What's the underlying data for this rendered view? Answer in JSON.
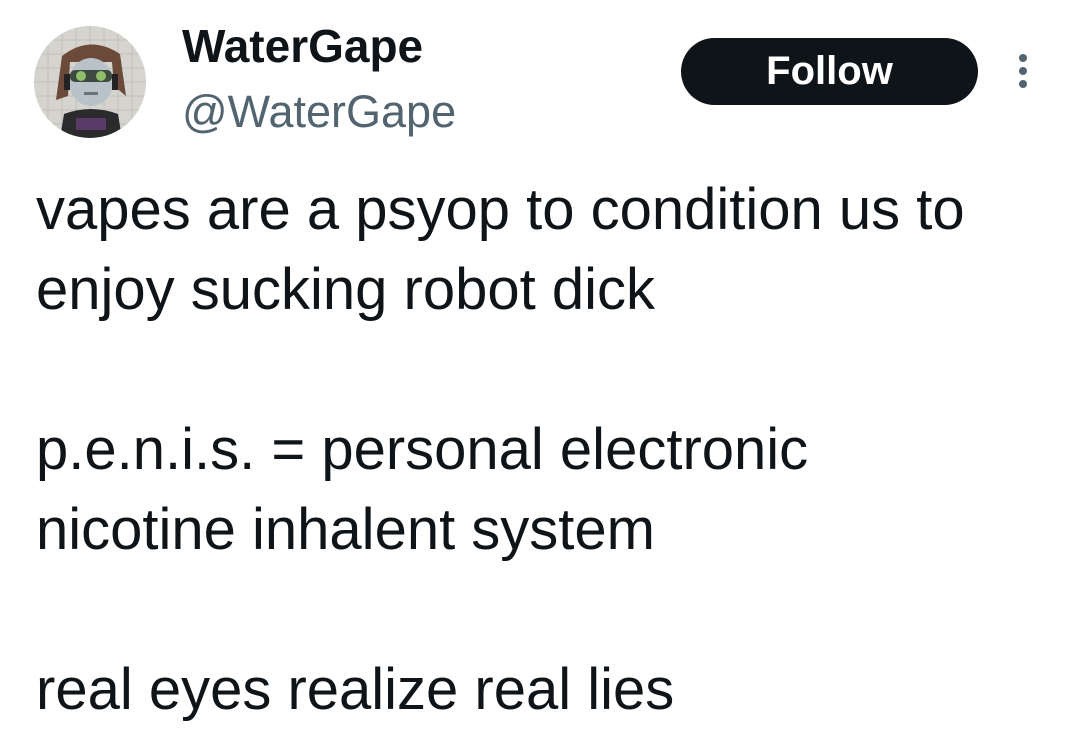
{
  "author": {
    "display_name": "WaterGape",
    "handle": "@WaterGape",
    "avatar_icon": "avatar-image"
  },
  "actions": {
    "follow_label": "Follow",
    "more_icon": "more-options-icon"
  },
  "tweet": {
    "lines": [
      "vapes are a psyop to condition us to",
      "enjoy sucking robot dick",
      "",
      "p.e.n.i.s. = personal electronic",
      "nicotine inhalent system",
      "",
      "real eyes realize real lies"
    ]
  },
  "colors": {
    "text": "#0f1419",
    "secondary_text": "#536471",
    "button_bg": "#0f1419",
    "button_text": "#ffffff"
  }
}
